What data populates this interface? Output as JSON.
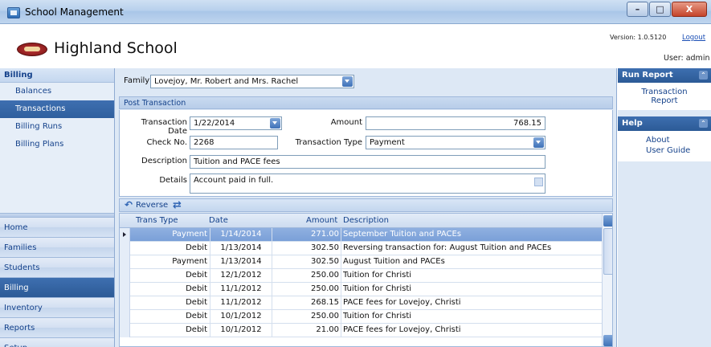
{
  "window": {
    "title": "School Management",
    "buttons": [
      "–",
      "□",
      "X"
    ]
  },
  "header": {
    "school_name": "Highland School",
    "version": "Version: 1.0.5120",
    "logout": "Logout",
    "user": "User: admin"
  },
  "nav": {
    "group_title": "Billing",
    "items": [
      {
        "label": "Balances",
        "active": false
      },
      {
        "label": "Transactions",
        "active": true
      },
      {
        "label": "Billing Runs",
        "active": false
      },
      {
        "label": "Billing Plans",
        "active": false
      }
    ],
    "sections": [
      {
        "label": "Home",
        "active": false
      },
      {
        "label": "Families",
        "active": false
      },
      {
        "label": "Students",
        "active": false
      },
      {
        "label": "Billing",
        "active": true
      },
      {
        "label": "Inventory",
        "active": false
      },
      {
        "label": "Reports",
        "active": false
      },
      {
        "label": "Setup",
        "active": false
      }
    ]
  },
  "family": {
    "label": "Family",
    "value": "Lovejoy, Mr. Robert and Mrs. Rachel"
  },
  "post": {
    "title": "Post Transaction",
    "date_label": "Transaction Date",
    "date_value": "1/22/2014",
    "amount_label": "Amount",
    "amount_value": "768.15",
    "check_label": "Check No.",
    "check_value": "2268",
    "type_label": "Transaction Type",
    "type_value": "Payment",
    "desc_label": "Description",
    "desc_value": "Tuition and PACE fees",
    "details_label": "Details",
    "details_value": "Account paid in full."
  },
  "toolbar": {
    "reverse": "Reverse"
  },
  "grid": {
    "columns": [
      "Trans Type",
      "Date",
      "Amount",
      "Description"
    ],
    "rows": [
      {
        "type": "Payment",
        "date": "1/14/2014",
        "amount": "271.00",
        "desc": "September Tuition and PACEs",
        "selected": true
      },
      {
        "type": "Debit",
        "date": "1/13/2014",
        "amount": "302.50",
        "desc": "Reversing transaction for: August Tuition and PACEs",
        "selected": false
      },
      {
        "type": "Payment",
        "date": "1/13/2014",
        "amount": "302.50",
        "desc": "August Tuition and PACEs",
        "selected": false
      },
      {
        "type": "Debit",
        "date": "12/1/2012",
        "amount": "250.00",
        "desc": "Tuition for Christi",
        "selected": false
      },
      {
        "type": "Debit",
        "date": "11/1/2012",
        "amount": "250.00",
        "desc": "Tuition for Christi",
        "selected": false
      },
      {
        "type": "Debit",
        "date": "11/1/2012",
        "amount": "268.15",
        "desc": "PACE fees for Lovejoy, Christi",
        "selected": false
      },
      {
        "type": "Debit",
        "date": "10/1/2012",
        "amount": "250.00",
        "desc": "Tuition for Christi",
        "selected": false
      },
      {
        "type": "Debit",
        "date": "10/1/2012",
        "amount": "21.00",
        "desc": "PACE fees for Lovejoy, Christi",
        "selected": false
      }
    ]
  },
  "right": {
    "run_report": {
      "title": "Run Report",
      "links": [
        "Transaction",
        "Report"
      ]
    },
    "help": {
      "title": "Help",
      "links": [
        "About",
        "User Guide"
      ]
    }
  }
}
